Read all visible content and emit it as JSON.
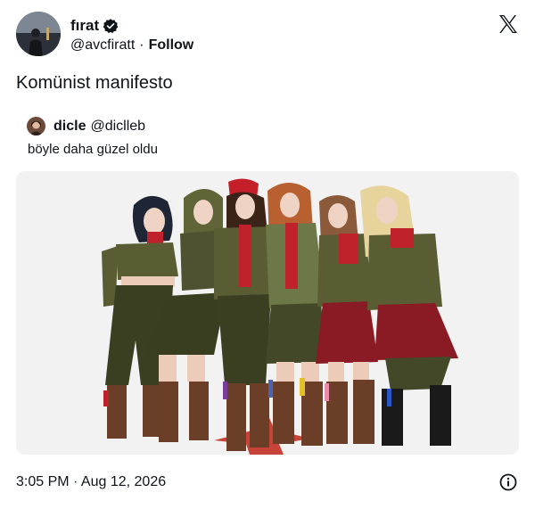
{
  "author": {
    "display_name": "fırat",
    "handle": "@avcfiratt",
    "separator": "·",
    "follow_label": "Follow",
    "verified": true
  },
  "tweet": {
    "text": "Komünist manifesto"
  },
  "quoted_tweet": {
    "display_name": "dicle",
    "handle": "@diclleb",
    "text": "böyle daha güzel oldu"
  },
  "photo": {
    "description_icon": "group-photo"
  },
  "footer": {
    "timestamp": "3:05 PM · Aug 12, 2026"
  },
  "colors": {
    "text": "#0f1419",
    "background": "#ffffff",
    "photo_bg": "#f3f3f3"
  }
}
